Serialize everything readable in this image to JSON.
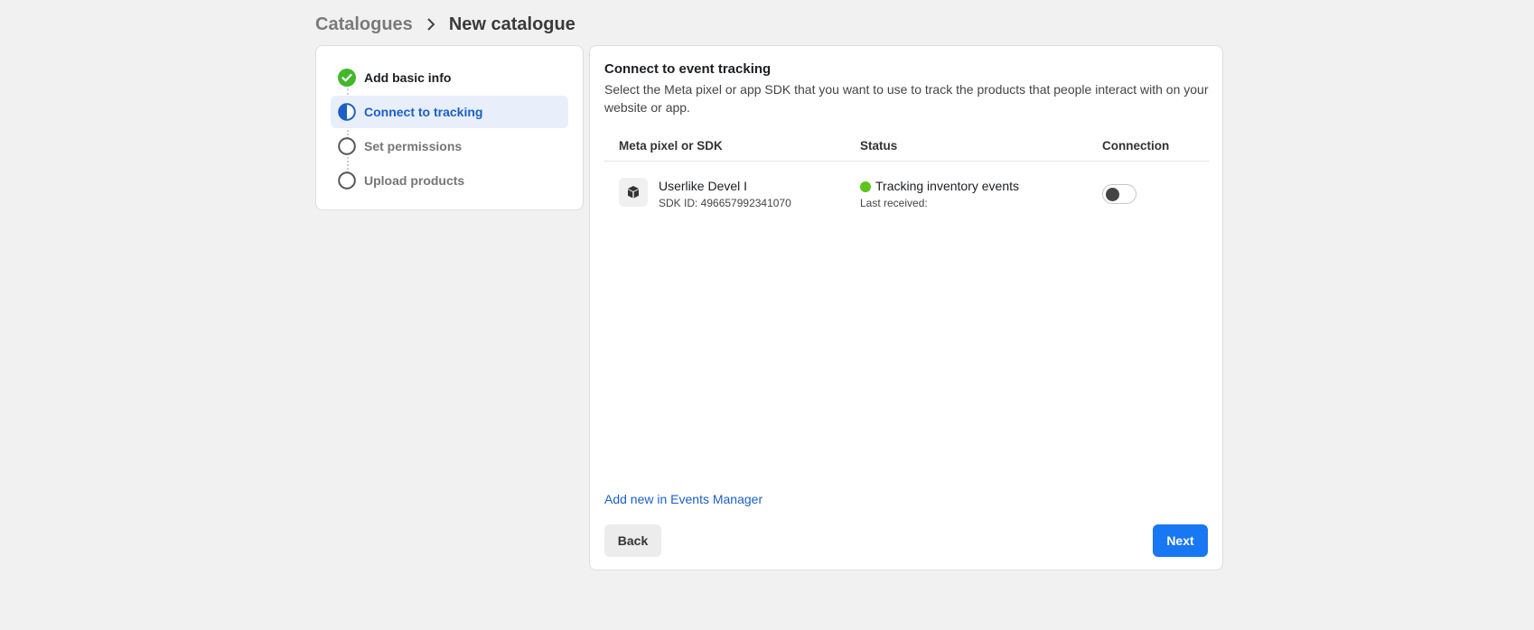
{
  "breadcrumb": {
    "parent": "Catalogues",
    "current": "New catalogue"
  },
  "steps": [
    {
      "label": "Add basic info",
      "state": "done"
    },
    {
      "label": "Connect to tracking",
      "state": "active"
    },
    {
      "label": "Set permissions",
      "state": "pending"
    },
    {
      "label": "Upload products",
      "state": "pending"
    }
  ],
  "main": {
    "title": "Connect to event tracking",
    "description": "Select the Meta pixel or app SDK that you want to use to track the products that people interact with on your website or app.",
    "table": {
      "columns": [
        "Meta pixel or SDK",
        "Status",
        "Connection"
      ],
      "rows": [
        {
          "name": "Userlike Devel I",
          "sdk_id": "SDK ID: 496657992341070",
          "status": "Tracking inventory events",
          "last_received": "Last received:",
          "connected": false
        }
      ]
    },
    "add_link": "Add new in Events Manager",
    "back_label": "Back",
    "next_label": "Next"
  },
  "colors": {
    "accent": "#1877f2",
    "link": "#1b5fc7",
    "status_ok": "#5ec41c",
    "step_done": "#42b72a"
  },
  "icons": {
    "breadcrumb_separator": "chevron-right-icon",
    "step_done": "check-circle-icon",
    "step_active": "half-circle-icon",
    "step_pending": "empty-circle-icon",
    "app": "cube-icon"
  }
}
